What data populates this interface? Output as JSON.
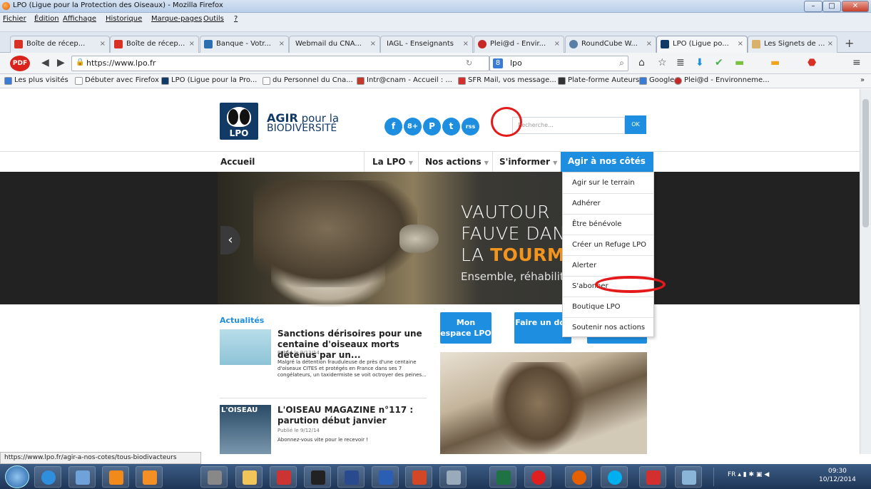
{
  "window": {
    "title": "LPO (Ligue pour la Protection des Oiseaux) - Mozilla Firefox"
  },
  "menubar": [
    "Fichier",
    "Édition",
    "Affichage",
    "Historique",
    "Marque-pages",
    "Outils",
    "?"
  ],
  "tabs": [
    {
      "label": "Boîte de récep...",
      "color": "#d93025"
    },
    {
      "label": "Boîte de récep...",
      "color": "#d93025"
    },
    {
      "label": "Banque - Votr...",
      "color": "#2a6fb0"
    },
    {
      "label": "Webmail du CNA...",
      "color": "#e8ecf2"
    },
    {
      "label": "IAGL - Enseignants",
      "color": "#e8ecf2"
    },
    {
      "label": "Plei@d - Envir...",
      "color": "#c62828"
    },
    {
      "label": "RoundCube W...",
      "color": "#5a7ea8"
    },
    {
      "label": "LPO (Ligue po...",
      "color": "#123a67",
      "active": true
    },
    {
      "label": "Les Signets de ...",
      "color": "#d8b26a"
    }
  ],
  "navbar": {
    "pdf": "PDF",
    "url": "https://www.lpo.fr",
    "search_engine": "8",
    "search_query": "lpo"
  },
  "bookmarks": [
    "Les plus visités",
    "Débuter avec Firefox",
    "LPO (Ligue pour la Pro...",
    "du Personnel du Cna...",
    "Intr@cnam - Accueil : ...",
    "SFR Mail, vos message...",
    "Plate-forme Auteurs",
    "Google",
    "Plei@d - Environneme..."
  ],
  "site": {
    "logo_text": "LPO",
    "tagline_1": "AGIR",
    "tagline_1b": "pour la",
    "tagline_2": "BIODIVERSITÉ",
    "social": [
      "f",
      "8+",
      "P",
      "t",
      "rss"
    ],
    "search_placeholder": "Recherche...",
    "search_button": "OK",
    "nav": [
      {
        "label": "Accueil"
      },
      {
        "label": "La LPO"
      },
      {
        "label": "Nos actions"
      },
      {
        "label": "S'informer"
      },
      {
        "label": "Agir à nos côtés"
      }
    ],
    "hero": {
      "line1": "VAUTOUR",
      "line2": "FAUVE DANS",
      "line3a": "LA",
      "line3b": "TOURMENTE",
      "subtitle": "Ensemble, réhabilitons"
    },
    "dropdown": [
      "Agir sur le terrain",
      "Adhérer",
      "Être bénévole",
      "Créer un Refuge LPO",
      "Alerter",
      "S'abonner",
      "Boutique LPO",
      "Soutenir nos actions"
    ],
    "news_section": "Actualités",
    "articles": [
      {
        "title": "Sanctions dérisoires pour une centaine d'oiseaux morts détenus par un...",
        "date": "Publié le 9/12/14",
        "desc": "Malgré la détention frauduleuse de près d'une centaine d'oiseaux CITES et protégés en France dans ses 7 congélateurs, un taxidermiste se voit octroyer des peines..."
      },
      {
        "title": "L'OISEAU MAGAZINE n°117 : parution début janvier",
        "date": "Publié le 9/12/14",
        "desc": "Abonnez-vous vite pour le recevoir !",
        "image_text": "L'OISEAU"
      }
    ],
    "buttons": [
      "Mon espace LPO",
      "Faire un don"
    ]
  },
  "status_url": "https://www.lpo.fr/agir-a-nos-cotes/tous-biodivacteurs",
  "tray": {
    "lang": "FR",
    "time": "09:30",
    "date": "10/12/2014"
  },
  "colors": {
    "accent": "#1e8ee0",
    "hero_highlight": "#f2941e",
    "annotation": "#e41a1a",
    "logo_bg": "#123a67"
  }
}
